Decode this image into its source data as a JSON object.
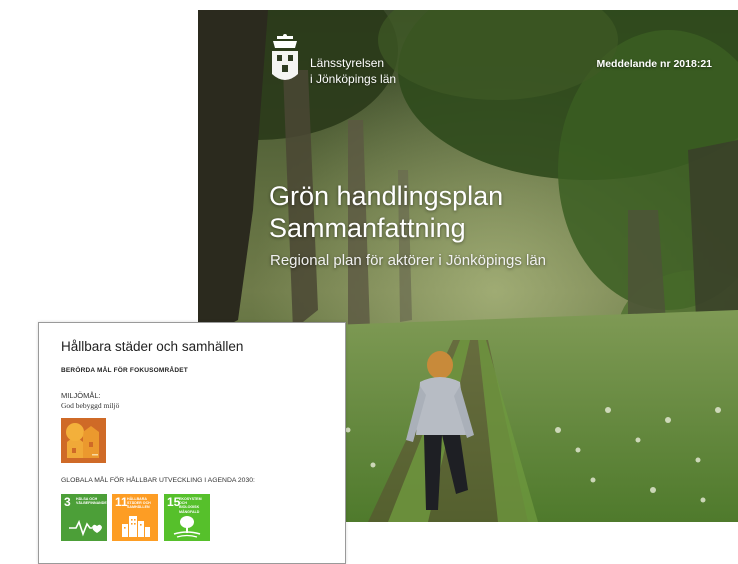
{
  "cover": {
    "agency_line1": "Länsstyrelsen",
    "agency_line2": "i Jönköpings län",
    "report_number": "Meddelande nr 2018:21",
    "title_line1": "Grön handlingsplan",
    "title_line2": "Sammanfattning",
    "subtitle": "Regional plan för aktörer i Jönköpings län",
    "logo_icon": "county-crest-icon"
  },
  "page": {
    "title": "Hållbara städer och samhällen",
    "section_heading": "BERÖRDA MÅL FÖR FOKUSOMRÅDET",
    "env_goal_label": "MILJÖMÅL:",
    "env_goal_value": "God bebyggd miljö",
    "env_goal_icon": "built-environment-icon",
    "env_goal_color": "#cf6a27",
    "sdg_heading": "GLOBALA MÅL FÖR HÅLLBAR UTVECKLING I AGENDA 2030:",
    "sdgs": [
      {
        "number": "3",
        "label": "HÄLSA OCH VÄLBEFINNANDE",
        "color": "#4c9f38",
        "icon": "heartbeat-icon"
      },
      {
        "number": "11",
        "label": "HÅLLBARA STÄDER OCH SAMHÄLLEN",
        "color": "#fd9d24",
        "icon": "city-buildings-icon"
      },
      {
        "number": "15",
        "label": "EKOSYSTEM OCH BIOLOGISK MÅNGFALD",
        "color": "#56c02b",
        "icon": "tree-icon"
      }
    ]
  }
}
